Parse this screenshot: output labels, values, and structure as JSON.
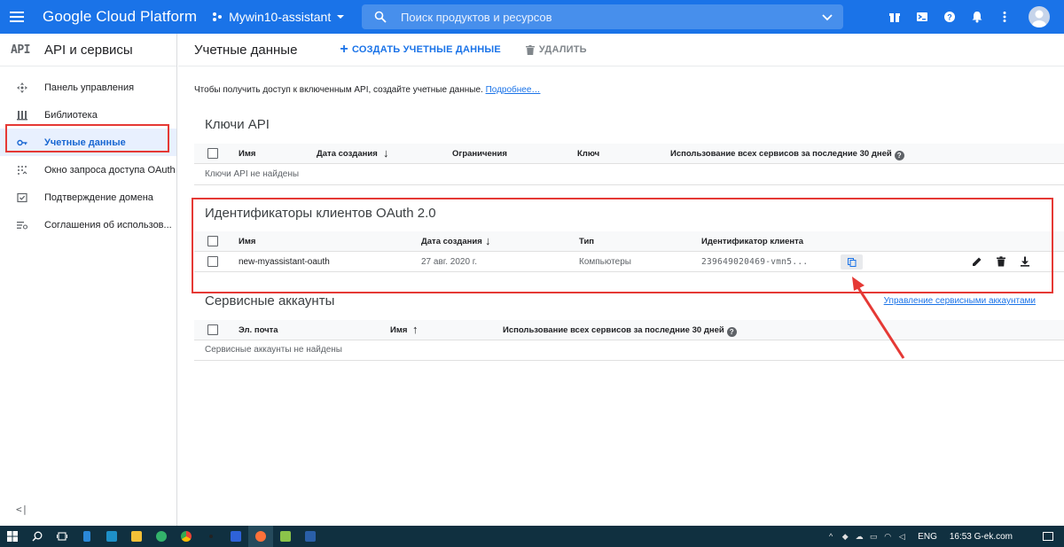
{
  "header": {
    "brand": "Google Cloud Platform",
    "project": "Mywin10-assistant",
    "search_placeholder": "Поиск продуктов и ресурсов"
  },
  "sidebar": {
    "api_logo": "API",
    "title": "API и сервисы",
    "items": [
      {
        "label": "Панель управления",
        "icon": "dashboard-icon"
      },
      {
        "label": "Библиотека",
        "icon": "library-icon"
      },
      {
        "label": "Учетные данные",
        "icon": "key-icon",
        "active": true
      },
      {
        "label": "Окно запроса доступа OAuth",
        "icon": "consent-icon"
      },
      {
        "label": "Подтверждение домена",
        "icon": "domain-check-icon"
      },
      {
        "label": "Соглашения об использов...",
        "icon": "agreements-icon"
      }
    ],
    "collapse_label": "<|"
  },
  "main": {
    "title": "Учетные данные",
    "create_button": "СОЗДАТЬ УЧЕТНЫЕ ДАННЫЕ",
    "delete_button": "УДАЛИТЬ",
    "intro_text": "Чтобы получить доступ к включенным API, создайте учетные данные.",
    "intro_link": "Подробнее…",
    "api_keys": {
      "title": "Ключи API",
      "columns": [
        "Имя",
        "Дата создания",
        "Ограничения",
        "Ключ",
        "Использование всех сервисов за последние 30 дней"
      ],
      "empty": "Ключи API не найдены"
    },
    "oauth": {
      "title": "Идентификаторы клиентов OAuth 2.0",
      "columns": [
        "Имя",
        "Дата создания",
        "Тип",
        "Идентификатор клиента"
      ],
      "rows": [
        {
          "name": "new-myassistant-oauth",
          "date": "27 авг. 2020 г.",
          "type": "Компьютеры",
          "client_id": "239649020469-vmn5..."
        }
      ]
    },
    "service_accounts": {
      "title": "Сервисные аккаунты",
      "manage_link": "Управление сервисными аккаунтами",
      "columns": [
        "Эл. почта",
        "Имя",
        "Использование всех сервисов за последние 30 дней"
      ],
      "empty": "Сервисные аккаунты не найдены"
    }
  },
  "taskbar": {
    "lang": "ENG",
    "clock": "16:53 G-ek.com"
  },
  "colors": {
    "header_bg": "#1a73e8",
    "highlight_red": "#e53935",
    "taskbar_bg": "#103040"
  }
}
